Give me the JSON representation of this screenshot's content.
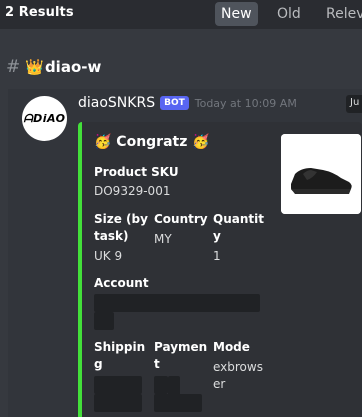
{
  "header": {
    "results_label": "2 Results",
    "tabs": [
      {
        "label": "New",
        "active": true
      },
      {
        "label": "Old",
        "active": false
      },
      {
        "label": "Relev",
        "active": false
      }
    ]
  },
  "channel": {
    "hash": "#",
    "emoji": "👑",
    "name": "diao-w"
  },
  "message": {
    "avatar_text": "ᗩDiAO",
    "author": "diaoSNKRS",
    "badge": "BOT",
    "timestamp": "Today at 10:09 AM",
    "jump_label": "Ju",
    "embed": {
      "accent_color": "#43e03a",
      "title": "🥳 Congratz 🥳",
      "fields": [
        {
          "name": "Product SKU",
          "value": "DO9329-001"
        },
        {
          "name": "Size (by task)",
          "name_lines": [
            "Size (by",
            "task)"
          ],
          "value": "UK 9"
        },
        {
          "name": "Country",
          "value": "MY"
        },
        {
          "name": "Quantity",
          "name_lines": [
            "Quantit",
            "y"
          ],
          "value": "1"
        },
        {
          "name": "Account",
          "value": ""
        },
        {
          "name": "Shipping",
          "name_lines": [
            "Shippin",
            "g"
          ],
          "value": ""
        },
        {
          "name": "Payment",
          "name_lines": [
            "Paymen",
            "t"
          ],
          "value": ""
        },
        {
          "name": "Mode",
          "value": "exbrowser",
          "value_lines": [
            "exbrows",
            "er"
          ]
        }
      ]
    }
  }
}
